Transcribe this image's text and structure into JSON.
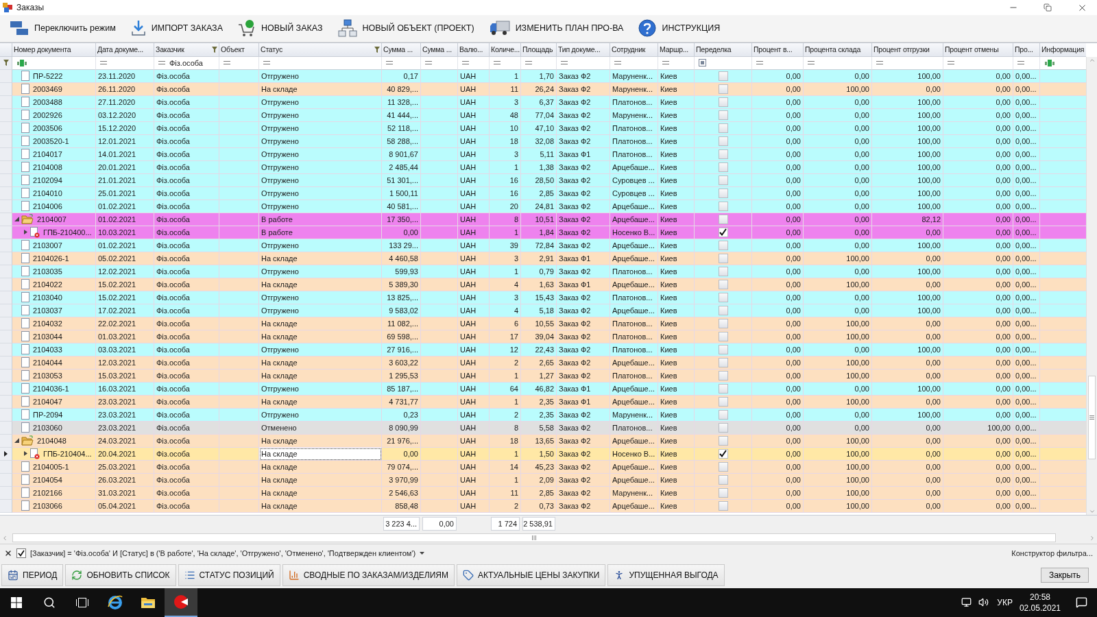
{
  "window": {
    "title": "Заказы"
  },
  "toolbar": [
    {
      "label": "Переключить режим"
    },
    {
      "label": "ИМПОРТ ЗАКАЗА"
    },
    {
      "label": "НОВЫЙ ЗАКАЗ"
    },
    {
      "label": "НОВЫЙ ОБЪЕКТ (ПРОЕКТ)"
    },
    {
      "label": "ИЗМЕНИТЬ ПЛАН ПРО-ВА"
    },
    {
      "label": "ИНСТРУКЦИЯ"
    }
  ],
  "table": {
    "columns": [
      {
        "label": "Номер документа",
        "filtered": false,
        "kind": "text"
      },
      {
        "label": "Дата докуме...",
        "filtered": false,
        "kind": "equals"
      },
      {
        "label": "Заказчик",
        "filtered": true,
        "kind": "equals",
        "filter_value": "Фіз.особа"
      },
      {
        "label": "Объект",
        "filtered": false,
        "kind": "equals"
      },
      {
        "label": "Статус",
        "filtered": true,
        "kind": "equals"
      },
      {
        "label": "Сумма ...",
        "filtered": false,
        "kind": "equals"
      },
      {
        "label": "Сумма ...",
        "filtered": false,
        "kind": "equals"
      },
      {
        "label": "Валю...",
        "filtered": false,
        "kind": "equals"
      },
      {
        "label": "Количе...",
        "filtered": false,
        "kind": "equals"
      },
      {
        "label": "Площадь",
        "filtered": false,
        "kind": "equals"
      },
      {
        "label": "Тип докуме...",
        "filtered": false,
        "kind": "equals"
      },
      {
        "label": "Сотрудник",
        "filtered": false,
        "kind": "equals"
      },
      {
        "label": "Маршр...",
        "filtered": false,
        "kind": "equals"
      },
      {
        "label": "Переделка",
        "filtered": false,
        "kind": "check"
      },
      {
        "label": "Процент в...",
        "filtered": false,
        "kind": "equals"
      },
      {
        "label": "Процента склада",
        "filtered": false,
        "kind": "equals"
      },
      {
        "label": "Процент отгрузки",
        "filtered": false,
        "kind": "equals"
      },
      {
        "label": "Процент отмены",
        "filtered": false,
        "kind": "equals"
      },
      {
        "label": "Про...",
        "filtered": false,
        "kind": "equals"
      },
      {
        "label": "Информация",
        "filtered": false,
        "kind": "text"
      }
    ],
    "rows": [
      {
        "kind": "document",
        "number": "ПР-5222",
        "date": "23.11.2020",
        "customer": "Фіз.особа",
        "status": "Отгружено",
        "sum": "0,17",
        "currency": "UAH",
        "qty": "1",
        "area": "1,70",
        "doc_type": "Заказ Ф2",
        "employee": "Маруненк...",
        "route": "Киев",
        "remake": false,
        "percent_v": "0,00",
        "percent_warehouse": "0,00",
        "percent_shipment": "100,00",
        "percent_cancel": "0,00",
        "column_pro": "0,00...",
        "color": "#bafcfd",
        "selected": false
      },
      {
        "kind": "document",
        "number": "2003469",
        "date": "26.11.2020",
        "customer": "Фіз.особа",
        "status": "На складе",
        "sum": "40 829,...",
        "currency": "UAH",
        "qty": "11",
        "area": "26,24",
        "doc_type": "Заказ Ф2",
        "employee": "Маруненк...",
        "route": "Киев",
        "remake": false,
        "percent_v": "0,00",
        "percent_warehouse": "100,00",
        "percent_shipment": "0,00",
        "percent_cancel": "0,00",
        "column_pro": "0,00...",
        "color": "#fde0c0",
        "selected": false
      },
      {
        "kind": "document",
        "number": "2003488",
        "date": "27.11.2020",
        "customer": "Фіз.особа",
        "status": "Отгружено",
        "sum": "11 328,...",
        "currency": "UAH",
        "qty": "3",
        "area": "6,37",
        "doc_type": "Заказ Ф2",
        "employee": "Платонов...",
        "route": "Киев",
        "remake": false,
        "percent_v": "0,00",
        "percent_warehouse": "0,00",
        "percent_shipment": "100,00",
        "percent_cancel": "0,00",
        "column_pro": "0,00...",
        "color": "#bafcfd",
        "selected": false
      },
      {
        "kind": "document",
        "number": "2002926",
        "date": "03.12.2020",
        "customer": "Фіз.особа",
        "status": "Отгружено",
        "sum": "41 444,...",
        "currency": "UAH",
        "qty": "48",
        "area": "77,04",
        "doc_type": "Заказ Ф2",
        "employee": "Маруненк...",
        "route": "Киев",
        "remake": false,
        "percent_v": "0,00",
        "percent_warehouse": "0,00",
        "percent_shipment": "100,00",
        "percent_cancel": "0,00",
        "column_pro": "0,00...",
        "color": "#bafcfd",
        "selected": false
      },
      {
        "kind": "document",
        "number": "2003506",
        "date": "15.12.2020",
        "customer": "Фіз.особа",
        "status": "Отгружено",
        "sum": "52 118,...",
        "currency": "UAH",
        "qty": "10",
        "area": "47,10",
        "doc_type": "Заказ Ф2",
        "employee": "Платонов...",
        "route": "Киев",
        "remake": false,
        "percent_v": "0,00",
        "percent_warehouse": "0,00",
        "percent_shipment": "100,00",
        "percent_cancel": "0,00",
        "column_pro": "0,00...",
        "color": "#bafcfd",
        "selected": false
      },
      {
        "kind": "document",
        "number": "2003520-1",
        "date": "12.01.2021",
        "customer": "Фіз.особа",
        "status": "Отгружено",
        "sum": "58 288,...",
        "currency": "UAH",
        "qty": "18",
        "area": "32,08",
        "doc_type": "Заказ Ф2",
        "employee": "Платонов...",
        "route": "Киев",
        "remake": false,
        "percent_v": "0,00",
        "percent_warehouse": "0,00",
        "percent_shipment": "100,00",
        "percent_cancel": "0,00",
        "column_pro": "0,00...",
        "color": "#bafcfd",
        "selected": false
      },
      {
        "kind": "document",
        "number": "2104017",
        "date": "14.01.2021",
        "customer": "Фіз.особа",
        "status": "Отгружено",
        "sum": "8 901,67",
        "currency": "UAH",
        "qty": "3",
        "area": "5,11",
        "doc_type": "Заказ Ф1",
        "employee": "Платонов...",
        "route": "Киев",
        "remake": false,
        "percent_v": "0,00",
        "percent_warehouse": "0,00",
        "percent_shipment": "100,00",
        "percent_cancel": "0,00",
        "column_pro": "0,00...",
        "color": "#bafcfd",
        "selected": false
      },
      {
        "kind": "document",
        "number": "2104008",
        "date": "20.01.2021",
        "customer": "Фіз.особа",
        "status": "Отгружено",
        "sum": "2 485,44",
        "currency": "UAH",
        "qty": "1",
        "area": "1,38",
        "doc_type": "Заказ Ф2",
        "employee": "Арцебаше...",
        "route": "Киев",
        "remake": false,
        "percent_v": "0,00",
        "percent_warehouse": "0,00",
        "percent_shipment": "100,00",
        "percent_cancel": "0,00",
        "column_pro": "0,00...",
        "color": "#bafcfd",
        "selected": false
      },
      {
        "kind": "document",
        "number": "2102094",
        "date": "21.01.2021",
        "customer": "Фіз.особа",
        "status": "Отгружено",
        "sum": "51 301,...",
        "currency": "UAH",
        "qty": "16",
        "area": "28,50",
        "doc_type": "Заказ Ф2",
        "employee": "Суровцев ...",
        "route": "Киев",
        "remake": false,
        "percent_v": "0,00",
        "percent_warehouse": "0,00",
        "percent_shipment": "100,00",
        "percent_cancel": "0,00",
        "column_pro": "0,00...",
        "color": "#bafcfd",
        "selected": false
      },
      {
        "kind": "document",
        "number": "2104010",
        "date": "25.01.2021",
        "customer": "Фіз.особа",
        "status": "Отгружено",
        "sum": "1 500,11",
        "currency": "UAH",
        "qty": "16",
        "area": "2,85",
        "doc_type": "Заказ Ф2",
        "employee": "Суровцев ...",
        "route": "Киев",
        "remake": false,
        "percent_v": "0,00",
        "percent_warehouse": "0,00",
        "percent_shipment": "100,00",
        "percent_cancel": "0,00",
        "column_pro": "0,00...",
        "color": "#bafcfd",
        "selected": false
      },
      {
        "kind": "document",
        "number": "2104006",
        "date": "01.02.2021",
        "customer": "Фіз.особа",
        "status": "Отгружено",
        "sum": "40 581,...",
        "currency": "UAH",
        "qty": "20",
        "area": "24,81",
        "doc_type": "Заказ Ф2",
        "employee": "Арцебаше...",
        "route": "Киев",
        "remake": false,
        "percent_v": "0,00",
        "percent_warehouse": "0,00",
        "percent_shipment": "100,00",
        "percent_cancel": "0,00",
        "column_pro": "0,00...",
        "color": "#bafcfd",
        "selected": false
      },
      {
        "kind": "group",
        "expanded": true,
        "number": "2104007",
        "date": "01.02.2021",
        "customer": "Фіз.особа",
        "status": "В работе",
        "sum": "17 350,...",
        "currency": "UAH",
        "qty": "8",
        "area": "10,51",
        "doc_type": "Заказ Ф2",
        "employee": "Арцебаше...",
        "route": "Киев",
        "remake": false,
        "percent_v": "0,00",
        "percent_warehouse": "0,00",
        "percent_shipment": "82,12",
        "percent_cancel": "0,00",
        "column_pro": "0,00...",
        "color": "#ee82ee",
        "selected": false,
        "children": [
          {
            "kind": "subdocument",
            "expanded": false,
            "number": "ГПБ-210400...",
            "date": "10.03.2021",
            "customer": "Фіз.особа",
            "status": "В работе",
            "sum": "0,00",
            "currency": "UAH",
            "qty": "1",
            "area": "1,84",
            "doc_type": "Заказ Ф2",
            "employee": "Носенко В...",
            "route": "Киев",
            "remake": true,
            "percent_v": "0,00",
            "percent_warehouse": "0,00",
            "percent_shipment": "0,00",
            "percent_cancel": "0,00",
            "column_pro": "0,00...",
            "color": "#ee82ee",
            "selected": false
          }
        ]
      },
      {
        "kind": "document",
        "number": "2103007",
        "date": "01.02.2021",
        "customer": "Фіз.особа",
        "status": "Отгружено",
        "sum": "133 29...",
        "currency": "UAH",
        "qty": "39",
        "area": "72,84",
        "doc_type": "Заказ Ф2",
        "employee": "Арцебаше...",
        "route": "Киев",
        "remake": false,
        "percent_v": "0,00",
        "percent_warehouse": "0,00",
        "percent_shipment": "100,00",
        "percent_cancel": "0,00",
        "column_pro": "0,00...",
        "color": "#bafcfd",
        "selected": false
      },
      {
        "kind": "document",
        "number": "2104026-1",
        "date": "05.02.2021",
        "customer": "Фіз.особа",
        "status": "На складе",
        "sum": "4 460,58",
        "currency": "UAH",
        "qty": "3",
        "area": "2,91",
        "doc_type": "Заказ Ф1",
        "employee": "Арцебаше...",
        "route": "Киев",
        "remake": false,
        "percent_v": "0,00",
        "percent_warehouse": "100,00",
        "percent_shipment": "0,00",
        "percent_cancel": "0,00",
        "column_pro": "0,00...",
        "color": "#fde0c0",
        "selected": false
      },
      {
        "kind": "document",
        "number": "2103035",
        "date": "12.02.2021",
        "customer": "Фіз.особа",
        "status": "Отгружено",
        "sum": "599,93",
        "currency": "UAH",
        "qty": "1",
        "area": "0,79",
        "doc_type": "Заказ Ф2",
        "employee": "Платонов...",
        "route": "Киев",
        "remake": false,
        "percent_v": "0,00",
        "percent_warehouse": "0,00",
        "percent_shipment": "100,00",
        "percent_cancel": "0,00",
        "column_pro": "0,00...",
        "color": "#bafcfd",
        "selected": false
      },
      {
        "kind": "document",
        "number": "2104022",
        "date": "15.02.2021",
        "customer": "Фіз.особа",
        "status": "На складе",
        "sum": "5 389,30",
        "currency": "UAH",
        "qty": "4",
        "area": "1,63",
        "doc_type": "Заказ Ф1",
        "employee": "Арцебаше...",
        "route": "Киев",
        "remake": false,
        "percent_v": "0,00",
        "percent_warehouse": "100,00",
        "percent_shipment": "0,00",
        "percent_cancel": "0,00",
        "column_pro": "0,00...",
        "color": "#fde0c0",
        "selected": false
      },
      {
        "kind": "document",
        "number": "2103040",
        "date": "15.02.2021",
        "customer": "Фіз.особа",
        "status": "Отгружено",
        "sum": "13 825,...",
        "currency": "UAH",
        "qty": "3",
        "area": "15,43",
        "doc_type": "Заказ Ф2",
        "employee": "Платонов...",
        "route": "Киев",
        "remake": false,
        "percent_v": "0,00",
        "percent_warehouse": "0,00",
        "percent_shipment": "100,00",
        "percent_cancel": "0,00",
        "column_pro": "0,00...",
        "color": "#bafcfd",
        "selected": false
      },
      {
        "kind": "document",
        "number": "2103037",
        "date": "17.02.2021",
        "customer": "Фіз.особа",
        "status": "Отгружено",
        "sum": "9 583,02",
        "currency": "UAH",
        "qty": "4",
        "area": "5,18",
        "doc_type": "Заказ Ф2",
        "employee": "Арцебаше...",
        "route": "Киев",
        "remake": false,
        "percent_v": "0,00",
        "percent_warehouse": "0,00",
        "percent_shipment": "100,00",
        "percent_cancel": "0,00",
        "column_pro": "0,00...",
        "color": "#bafcfd",
        "selected": false
      },
      {
        "kind": "document",
        "number": "2104032",
        "date": "22.02.2021",
        "customer": "Фіз.особа",
        "status": "На складе",
        "sum": "11 082,...",
        "currency": "UAH",
        "qty": "6",
        "area": "10,55",
        "doc_type": "Заказ Ф2",
        "employee": "Платонов...",
        "route": "Киев",
        "remake": false,
        "percent_v": "0,00",
        "percent_warehouse": "100,00",
        "percent_shipment": "0,00",
        "percent_cancel": "0,00",
        "column_pro": "0,00...",
        "color": "#fde0c0",
        "selected": false
      },
      {
        "kind": "document",
        "number": "2103044",
        "date": "01.03.2021",
        "customer": "Фіз.особа",
        "status": "На складе",
        "sum": "69 598,...",
        "currency": "UAH",
        "qty": "17",
        "area": "39,04",
        "doc_type": "Заказ Ф2",
        "employee": "Платонов...",
        "route": "Киев",
        "remake": false,
        "percent_v": "0,00",
        "percent_warehouse": "100,00",
        "percent_shipment": "0,00",
        "percent_cancel": "0,00",
        "column_pro": "0,00...",
        "color": "#fde0c0",
        "selected": false
      },
      {
        "kind": "document",
        "number": "2104033",
        "date": "03.03.2021",
        "customer": "Фіз.особа",
        "status": "Отгружено",
        "sum": "27 916,...",
        "currency": "UAH",
        "qty": "12",
        "area": "22,43",
        "doc_type": "Заказ Ф2",
        "employee": "Платонов...",
        "route": "Киев",
        "remake": false,
        "percent_v": "0,00",
        "percent_warehouse": "0,00",
        "percent_shipment": "100,00",
        "percent_cancel": "0,00",
        "column_pro": "0,00...",
        "color": "#bafcfd",
        "selected": false
      },
      {
        "kind": "document",
        "number": "2104044",
        "date": "12.03.2021",
        "customer": "Фіз.особа",
        "status": "На складе",
        "sum": "3 603,22",
        "currency": "UAH",
        "qty": "2",
        "area": "2,65",
        "doc_type": "Заказ Ф2",
        "employee": "Арцебаше...",
        "route": "Киев",
        "remake": false,
        "percent_v": "0,00",
        "percent_warehouse": "100,00",
        "percent_shipment": "0,00",
        "percent_cancel": "0,00",
        "column_pro": "0,00...",
        "color": "#fde0c0",
        "selected": false
      },
      {
        "kind": "document",
        "number": "2103053",
        "date": "15.03.2021",
        "customer": "Фіз.особа",
        "status": "На складе",
        "sum": "1 295,53",
        "currency": "UAH",
        "qty": "1",
        "area": "1,27",
        "doc_type": "Заказ Ф2",
        "employee": "Платонов...",
        "route": "Киев",
        "remake": false,
        "percent_v": "0,00",
        "percent_warehouse": "100,00",
        "percent_shipment": "0,00",
        "percent_cancel": "0,00",
        "column_pro": "0,00...",
        "color": "#fde0c0",
        "selected": false
      },
      {
        "kind": "document",
        "number": "2104036-1",
        "date": "16.03.2021",
        "customer": "Фіз.особа",
        "status": "Отгружено",
        "sum": "85 187,...",
        "currency": "UAH",
        "qty": "64",
        "area": "46,82",
        "doc_type": "Заказ Ф1",
        "employee": "Арцебаше...",
        "route": "Киев",
        "remake": false,
        "percent_v": "0,00",
        "percent_warehouse": "0,00",
        "percent_shipment": "100,00",
        "percent_cancel": "0,00",
        "column_pro": "0,00...",
        "color": "#bafcfd",
        "selected": false
      },
      {
        "kind": "document",
        "number": "2104047",
        "date": "23.03.2021",
        "customer": "Фіз.особа",
        "status": "На складе",
        "sum": "4 731,77",
        "currency": "UAH",
        "qty": "1",
        "area": "2,35",
        "doc_type": "Заказ Ф1",
        "employee": "Арцебаше...",
        "route": "Киев",
        "remake": false,
        "percent_v": "0,00",
        "percent_warehouse": "100,00",
        "percent_shipment": "0,00",
        "percent_cancel": "0,00",
        "column_pro": "0,00...",
        "color": "#fde0c0",
        "selected": false
      },
      {
        "kind": "document",
        "number": "ПР-2094",
        "date": "23.03.2021",
        "customer": "Фіз.особа",
        "status": "Отгружено",
        "sum": "0,23",
        "currency": "UAH",
        "qty": "2",
        "area": "2,35",
        "doc_type": "Заказ Ф2",
        "employee": "Маруненк...",
        "route": "Киев",
        "remake": false,
        "percent_v": "0,00",
        "percent_warehouse": "0,00",
        "percent_shipment": "100,00",
        "percent_cancel": "0,00",
        "column_pro": "0,00...",
        "color": "#bafcfd",
        "selected": false
      },
      {
        "kind": "document",
        "number": "2103060",
        "date": "23.03.2021",
        "customer": "Фіз.особа",
        "status": "Отменено",
        "sum": "8 090,99",
        "currency": "UAH",
        "qty": "8",
        "area": "5,58",
        "doc_type": "Заказ Ф2",
        "employee": "Платонов...",
        "route": "Киев",
        "remake": false,
        "percent_v": "0,00",
        "percent_warehouse": "0,00",
        "percent_shipment": "0,00",
        "percent_cancel": "100,00",
        "column_pro": "0,00...",
        "color": "#e0e0e0",
        "selected": false
      },
      {
        "kind": "group",
        "expanded": true,
        "number": "2104048",
        "date": "24.03.2021",
        "customer": "Фіз.особа",
        "status": "На складе",
        "sum": "21 976,...",
        "currency": "UAH",
        "qty": "18",
        "area": "13,65",
        "doc_type": "Заказ Ф2",
        "employee": "Арцебаше...",
        "route": "Киев",
        "remake": false,
        "percent_v": "0,00",
        "percent_warehouse": "100,00",
        "percent_shipment": "0,00",
        "percent_cancel": "0,00",
        "column_pro": "0,00...",
        "color": "#fde0c0",
        "selected": false,
        "children": [
          {
            "kind": "subdocument",
            "expanded": false,
            "number": "ГПБ-210404...",
            "date": "20.04.2021",
            "customer": "Фіз.особа",
            "status": "На складе",
            "sum": "0,00",
            "currency": "UAH",
            "qty": "1",
            "area": "1,50",
            "doc_type": "Заказ Ф2",
            "employee": "Носенко В...",
            "route": "Киев",
            "remake": true,
            "percent_v": "0,00",
            "percent_warehouse": "100,00",
            "percent_shipment": "0,00",
            "percent_cancel": "0,00",
            "column_pro": "0,00...",
            "color": "#ffe8a6",
            "selected": true
          }
        ]
      },
      {
        "kind": "document",
        "number": "2104005-1",
        "date": "25.03.2021",
        "customer": "Фіз.особа",
        "status": "На складе",
        "sum": "79 074,...",
        "currency": "UAH",
        "qty": "14",
        "area": "45,23",
        "doc_type": "Заказ Ф2",
        "employee": "Арцебаше...",
        "route": "Киев",
        "remake": false,
        "percent_v": "0,00",
        "percent_warehouse": "100,00",
        "percent_shipment": "0,00",
        "percent_cancel": "0,00",
        "column_pro": "0,00...",
        "color": "#fde0c0",
        "selected": false
      },
      {
        "kind": "document",
        "number": "2104054",
        "date": "26.03.2021",
        "customer": "Фіз.особа",
        "status": "На складе",
        "sum": "3 970,99",
        "currency": "UAH",
        "qty": "1",
        "area": "2,09",
        "doc_type": "Заказ Ф2",
        "employee": "Арцебаше...",
        "route": "Киев",
        "remake": false,
        "percent_v": "0,00",
        "percent_warehouse": "100,00",
        "percent_shipment": "0,00",
        "percent_cancel": "0,00",
        "column_pro": "0,00...",
        "color": "#fde0c0",
        "selected": false
      },
      {
        "kind": "document",
        "number": "2102166",
        "date": "31.03.2021",
        "customer": "Фіз.особа",
        "status": "На складе",
        "sum": "2 546,63",
        "currency": "UAH",
        "qty": "11",
        "area": "2,85",
        "doc_type": "Заказ Ф2",
        "employee": "Маруненк...",
        "route": "Киев",
        "remake": false,
        "percent_v": "0,00",
        "percent_warehouse": "100,00",
        "percent_shipment": "0,00",
        "percent_cancel": "0,00",
        "column_pro": "0,00...",
        "color": "#fde0c0",
        "selected": false
      },
      {
        "kind": "document",
        "number": "2103066",
        "date": "05.04.2021",
        "customer": "Фіз.особа",
        "status": "На складе",
        "sum": "858,48",
        "currency": "UAH",
        "qty": "2",
        "area": "0,73",
        "doc_type": "Заказ Ф2",
        "employee": "Арцебаше...",
        "route": "Киев",
        "remake": false,
        "percent_v": "0,00",
        "percent_warehouse": "100,00",
        "percent_shipment": "0,00",
        "percent_cancel": "0,00",
        "column_pro": "0,00...",
        "color": "#fde0c0",
        "selected": false
      }
    ],
    "totals": {
      "sum": "3 223 4...",
      "sum_2": "0,00",
      "qty": "1 724",
      "area": "2 538,91"
    }
  },
  "filter_bar": {
    "enabled": true,
    "expression": "[Заказчик] = 'Фіз.особа' И [Статус] в ('В работе', 'На складе', 'Отгружено', 'Отменено', 'Подтвержден клиентом')",
    "builder_link": "Конструктор фильтра..."
  },
  "bottom_buttons": [
    {
      "label": "ПЕРИОД"
    },
    {
      "label": "ОБНОВИТЬ СПИСОК"
    },
    {
      "label": "СТАТУС ПОЗИЦИЙ"
    },
    {
      "label": "СВОДНЫЕ ПО ЗАКАЗАМ/ИЗДЕЛИЯМ"
    },
    {
      "label": "АКТУАЛЬНЫЕ ЦЕНЫ ЗАКУПКИ"
    },
    {
      "label": "УПУЩЕННАЯ ВЫГОДА"
    }
  ],
  "close_button": "Закрыть",
  "taskbar": {
    "language": "УКР",
    "time": "20:58",
    "date": "02.05.2021"
  }
}
